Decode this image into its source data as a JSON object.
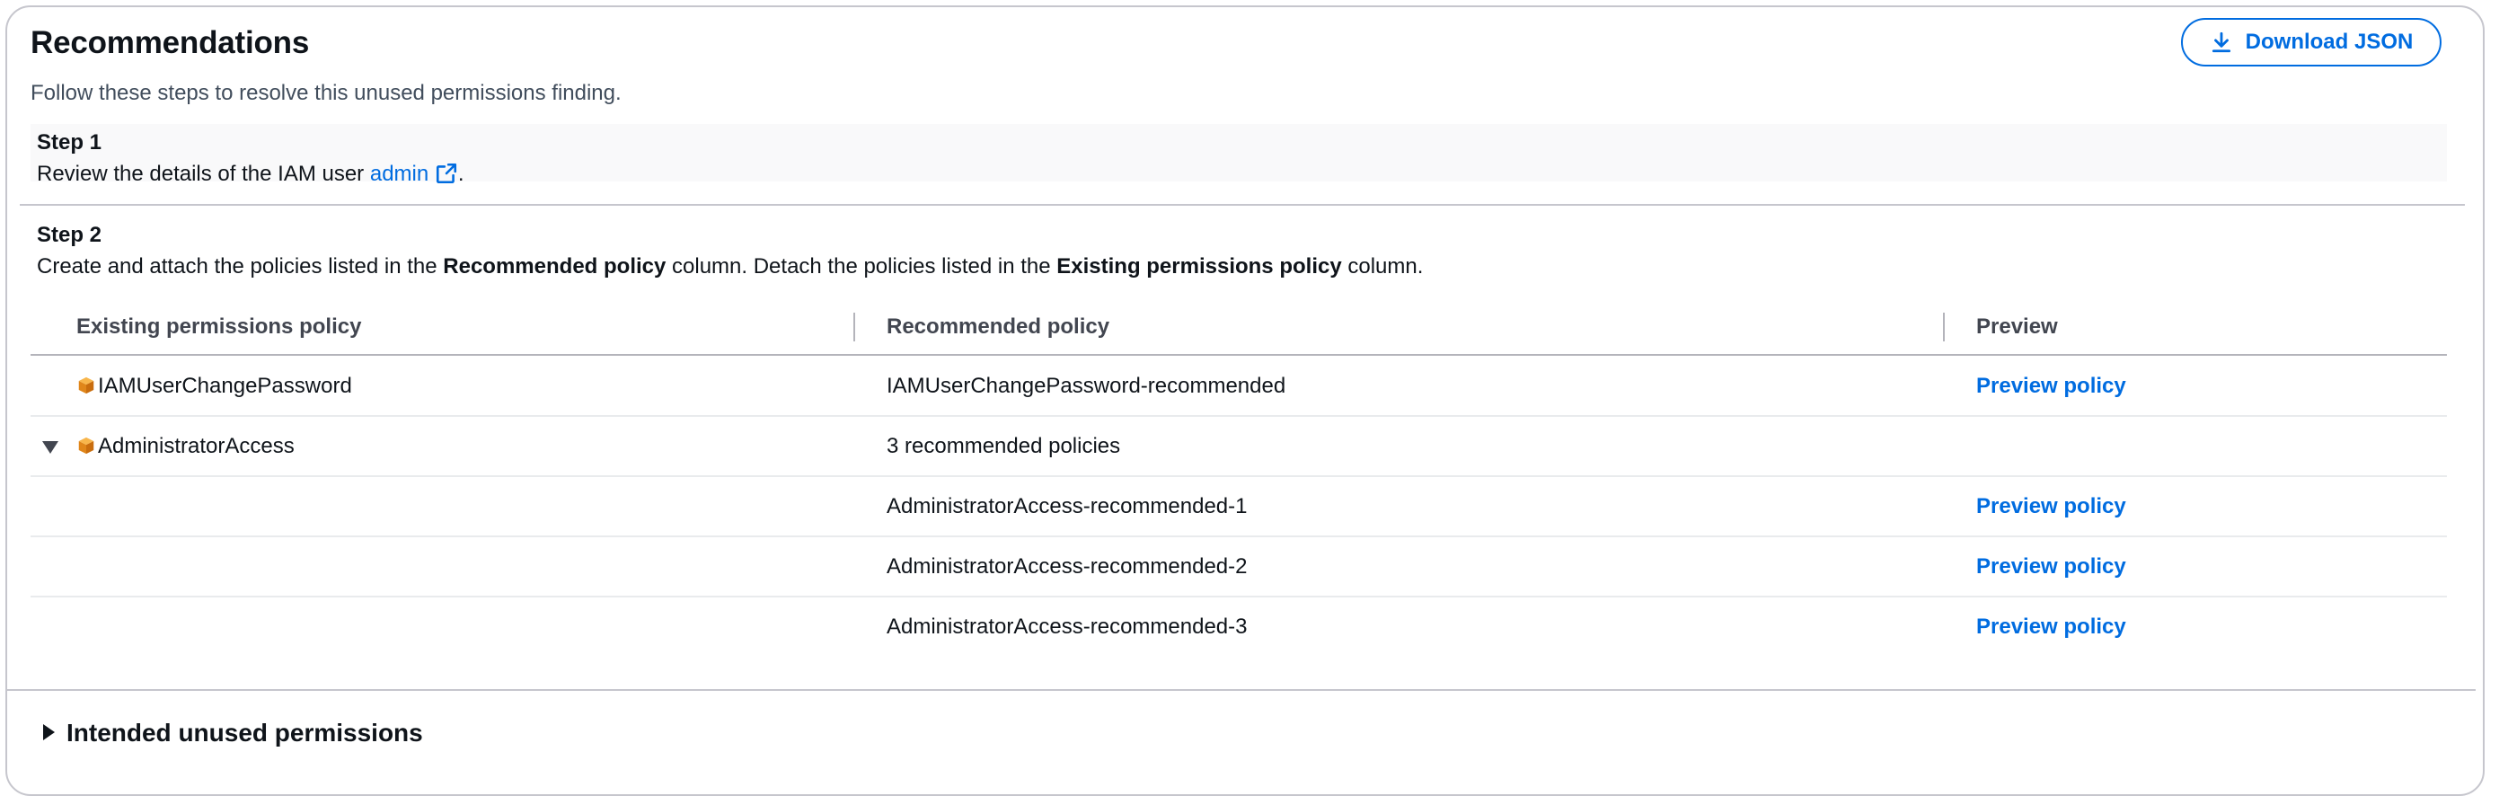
{
  "header": {
    "title": "Recommendations",
    "subtitle": "Follow these steps to resolve this unused permissions finding.",
    "download_label": "Download JSON"
  },
  "step1": {
    "heading": "Step 1",
    "text_before": "Review the details of the IAM user ",
    "link_text": "admin",
    "text_after": "."
  },
  "step2": {
    "heading": "Step 2",
    "t1": "Create and attach the policies listed in the ",
    "b1": "Recommended policy",
    "t2": " column. Detach the policies listed in the ",
    "b2": "Existing permissions policy",
    "t3": " column."
  },
  "table": {
    "headers": [
      "Existing permissions policy",
      "Recommended policy",
      "Preview"
    ],
    "rows": [
      {
        "existing": "IAMUserChangePassword",
        "recommended": "IAMUserChangePassword-recommended",
        "preview": "Preview policy"
      },
      {
        "existing": "AdministratorAccess",
        "recommended": "3 recommended policies",
        "preview": ""
      },
      {
        "existing": "",
        "recommended": "AdministratorAccess-recommended-1",
        "preview": "Preview policy"
      },
      {
        "existing": "",
        "recommended": "AdministratorAccess-recommended-2",
        "preview": "Preview policy"
      },
      {
        "existing": "",
        "recommended": "AdministratorAccess-recommended-3",
        "preview": "Preview policy"
      }
    ]
  },
  "intended": {
    "label": "Intended unused permissions"
  },
  "icons": {
    "download": "download-icon",
    "external": "external-link-icon",
    "policy": "aws-managed-policy-icon",
    "caret_down": "caret-down-icon",
    "caret_right": "caret-right-icon"
  },
  "colors": {
    "link": "#006ce0",
    "border": "#c6c6cd",
    "text": "#0f141a",
    "cube": "#f29d1f"
  }
}
